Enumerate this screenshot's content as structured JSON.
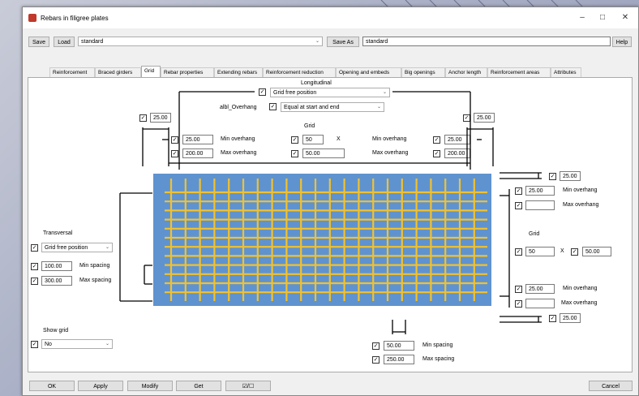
{
  "window": {
    "title": "Rebars in filigree plates"
  },
  "toolbar": {
    "save": "Save",
    "load": "Load",
    "preset": "standard",
    "save_as": "Save As",
    "save_as_name": "standard",
    "help": "Help"
  },
  "tabs": [
    "Reinforcement",
    "Braced girders",
    "Grid",
    "Rebar properties",
    "Extending rebars",
    "Reinforcement reduction",
    "Opening and embeds",
    "Big openings",
    "Anchor length",
    "Reinforcement areas",
    "Attributes"
  ],
  "longitudinal": {
    "title": "Longitudinal",
    "position": "Grid free position",
    "overhang_label": "albl_Overhang",
    "overhang_mode": "Equal at start and end",
    "left_offset": "25.00",
    "right_offset": "25.00",
    "grid_label": "Grid",
    "x_sign": "X",
    "min_overhang_label": "Min overhang",
    "max_overhang_label": "Max overhang",
    "left_min_overhang": "25.00",
    "left_max_overhang": "200.00",
    "grid_count": "50",
    "grid_spacing": "50.00",
    "right_min_overhang": "25.00",
    "right_max_overhang": "200.00"
  },
  "right_side": {
    "top_offset": "25.00",
    "min_overhang": "25.00",
    "min_overhang_label": "Min overhang",
    "max_overhang": "",
    "max_overhang_label": "Max overhang",
    "grid_label": "Grid",
    "grid_count": "50",
    "x_sign": "X",
    "grid_spacing": "50.00",
    "bottom_min_overhang": "25.00",
    "bottom_min_overhang_label": "Min overhang",
    "bottom_max_overhang": "",
    "bottom_max_overhang_label": "Max overhang",
    "bottom_offset": "25.00"
  },
  "transversal": {
    "title": "Transversal",
    "position": "Grid free position",
    "min_spacing": "100.00",
    "min_spacing_label": "Min spacing",
    "max_spacing": "300.00",
    "max_spacing_label": "Max spacing"
  },
  "show_grid": {
    "label": "Show grid",
    "value": "No"
  },
  "bottom_spacing": {
    "min": "50.00",
    "min_label": "Min spacing",
    "max": "250.00",
    "max_label": "Max spacing"
  },
  "footer": {
    "ok": "OK",
    "apply": "Apply",
    "modify": "Modify",
    "get": "Get",
    "toggle": "☑/☐",
    "cancel": "Cancel"
  },
  "colors": {
    "plate": "#5f93cf",
    "rebar": "#f2c12e"
  }
}
